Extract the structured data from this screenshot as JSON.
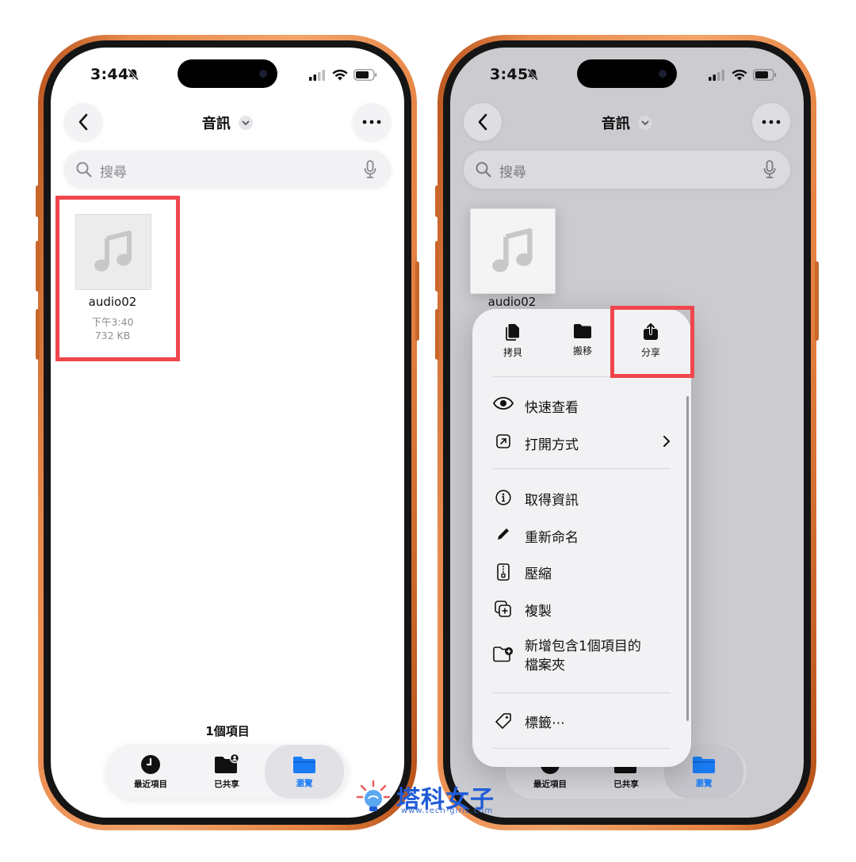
{
  "left": {
    "time": "3:44",
    "nav_title": "音訊",
    "search_placeholder": "搜尋",
    "file": {
      "name": "audio02",
      "date": "下午3:40",
      "size": "732 KB"
    },
    "item_count": "1個項目",
    "tabs": [
      {
        "label": "最近項目",
        "icon": "clock-icon"
      },
      {
        "label": "已共享",
        "icon": "shared-folder-icon"
      },
      {
        "label": "瀏覽",
        "icon": "folder-icon",
        "selected": true
      }
    ]
  },
  "right": {
    "time": "3:45",
    "nav_title": "音訊",
    "search_placeholder": "搜尋",
    "file": {
      "name": "audio02"
    },
    "quick_actions": [
      {
        "label": "拷貝",
        "icon": "copy-icon"
      },
      {
        "label": "搬移",
        "icon": "folder-icon"
      },
      {
        "label": "分享",
        "icon": "share-icon"
      }
    ],
    "menu_items": [
      {
        "label": "快速查看",
        "icon": "eye-icon"
      },
      {
        "label": "打開方式",
        "icon": "open-with-icon"
      },
      {
        "label": "取得資訊",
        "icon": "info-icon"
      },
      {
        "label": "重新命名",
        "icon": "pencil-icon"
      },
      {
        "label": "壓縮",
        "icon": "zip-icon"
      },
      {
        "label": "複製",
        "icon": "duplicate-icon"
      },
      {
        "label": "新增包含1個項目的\n檔案夾",
        "icon": "new-folder-icon"
      },
      {
        "label": "標籤⋯",
        "icon": "tag-icon"
      }
    ],
    "tabs": [
      {
        "label": "最近項目"
      },
      {
        "label": "已共享"
      },
      {
        "label": "瀏覽",
        "selected": true
      }
    ]
  },
  "watermark": {
    "name": "塔科女子",
    "url": "www.tech-girlz.com"
  },
  "colors": {
    "highlight": "#f0464e",
    "accent": "#1a7cf5",
    "frame": "#e98a4e"
  }
}
